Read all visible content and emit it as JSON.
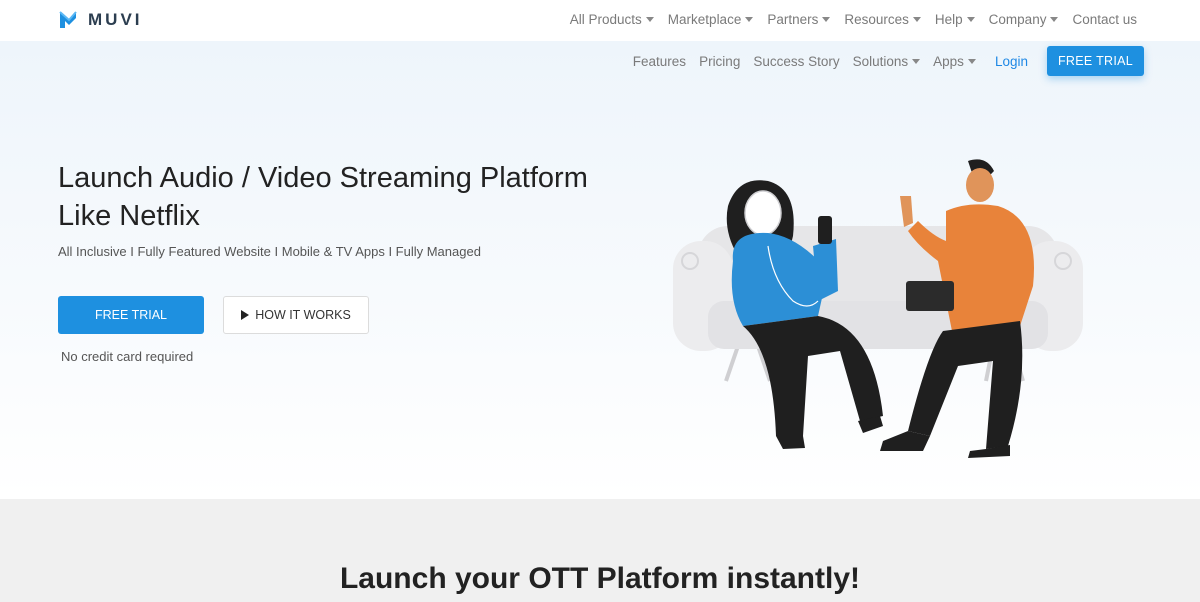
{
  "brand": {
    "name": "MUVI",
    "accent": "#1e90e0",
    "logo_color": "#1e90e0"
  },
  "topnav": [
    {
      "label": "All Products",
      "dropdown": true
    },
    {
      "label": "Marketplace",
      "dropdown": true
    },
    {
      "label": "Partners",
      "dropdown": true
    },
    {
      "label": "Resources",
      "dropdown": true
    },
    {
      "label": "Help",
      "dropdown": true
    },
    {
      "label": "Company",
      "dropdown": true
    },
    {
      "label": "Contact us",
      "dropdown": false
    }
  ],
  "subnav": {
    "items": [
      {
        "label": "Features",
        "dropdown": false
      },
      {
        "label": "Pricing",
        "dropdown": false
      },
      {
        "label": "Success Story",
        "dropdown": false
      },
      {
        "label": "Solutions",
        "dropdown": true
      },
      {
        "label": "Apps",
        "dropdown": true
      }
    ],
    "login": "Login",
    "trial": "FREE TRIAL"
  },
  "hero": {
    "title": "Launch Audio / Video Streaming Platform Like Netflix",
    "subtitle": "All Inclusive I Fully Featured Website I Mobile & TV Apps I Fully Managed",
    "primary_cta": "FREE TRIAL",
    "secondary_cta": "HOW IT WORKS",
    "note": "No credit card required"
  },
  "illustration": {
    "icon": "people-on-couch-illustration",
    "colors": {
      "woman_top": "#2c8fd6",
      "man_top": "#e8833a",
      "couch": "#e6e6e8",
      "pants": "#1f1f1f"
    }
  },
  "section": {
    "title": "Launch your OTT Platform instantly!"
  }
}
